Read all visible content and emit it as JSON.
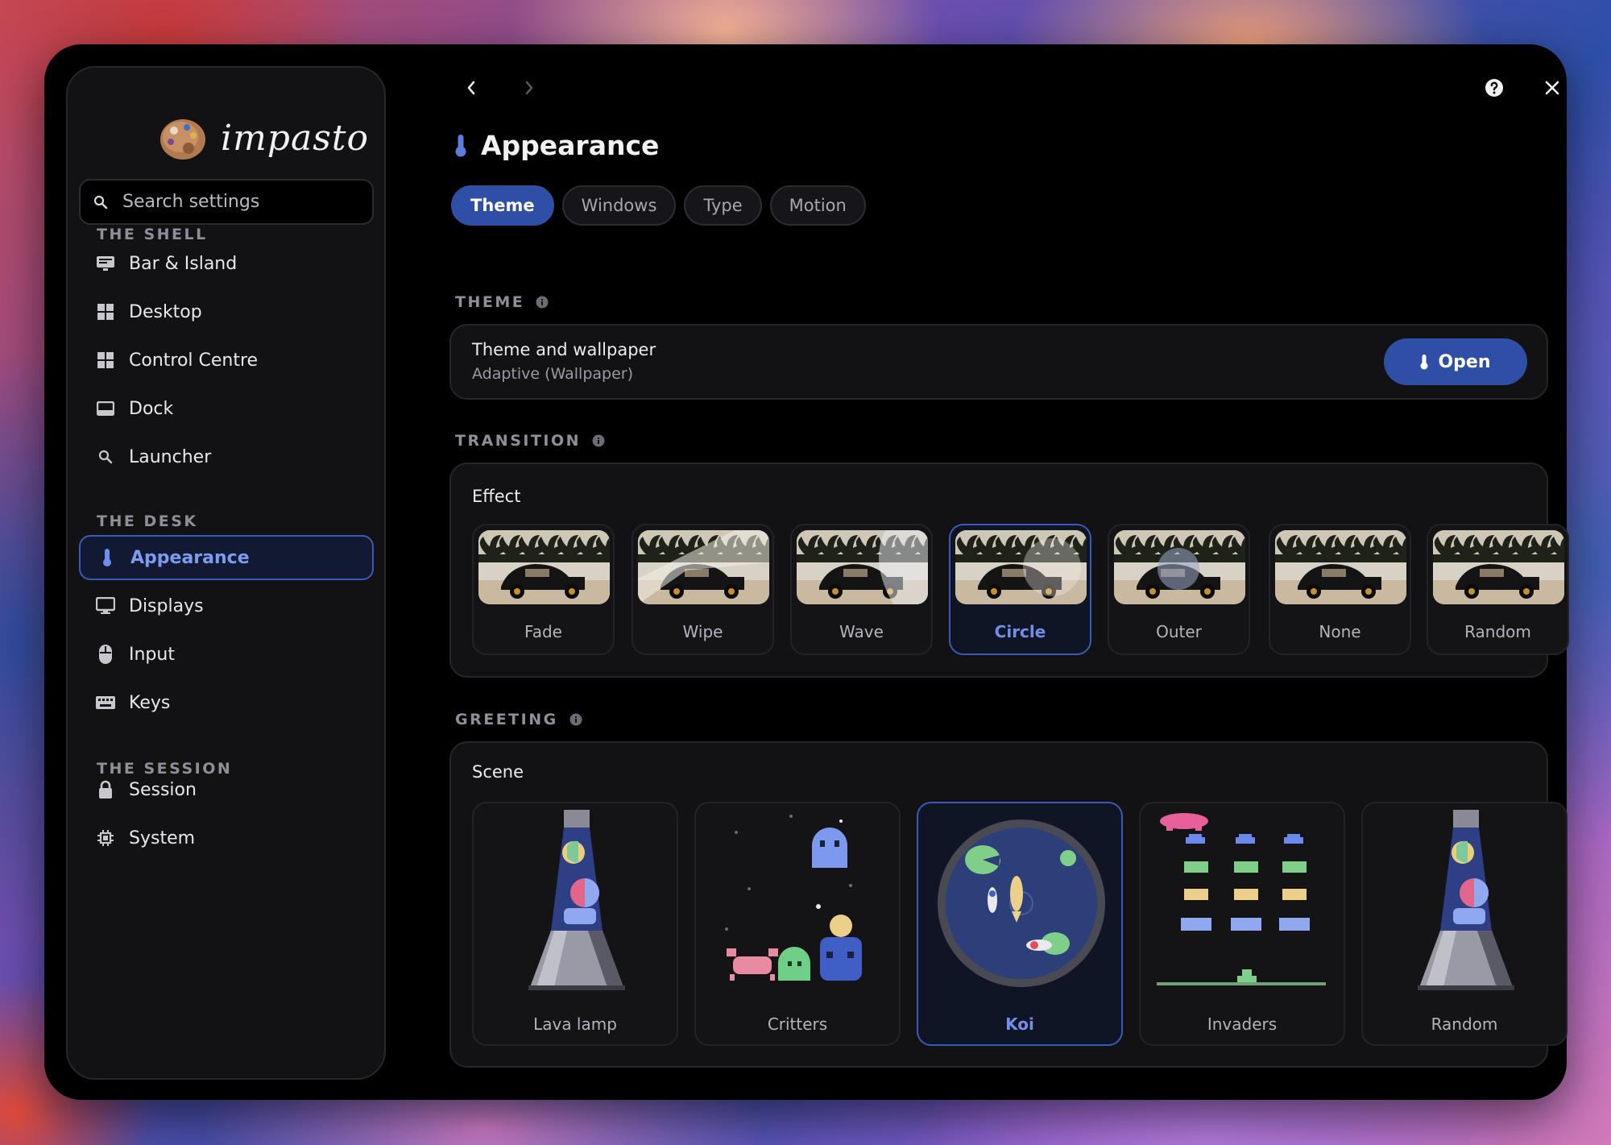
{
  "app": {
    "name": "impasto"
  },
  "search": {
    "placeholder": "Search settings"
  },
  "sidebar": {
    "sections": [
      {
        "label": "THE SHELL",
        "items": [
          {
            "label": "Bar & Island",
            "icon": "monitor-bar-icon"
          },
          {
            "label": "Desktop",
            "icon": "grid-icon"
          },
          {
            "label": "Control Centre",
            "icon": "grid-icon"
          },
          {
            "label": "Dock",
            "icon": "dock-icon"
          },
          {
            "label": "Launcher",
            "icon": "search-icon"
          }
        ]
      },
      {
        "label": "THE DESK",
        "items": [
          {
            "label": "Appearance",
            "icon": "thermometer-icon",
            "active": true
          },
          {
            "label": "Displays",
            "icon": "monitor-icon"
          },
          {
            "label": "Input",
            "icon": "mouse-icon"
          },
          {
            "label": "Keys",
            "icon": "keyboard-icon"
          }
        ]
      },
      {
        "label": "THE SESSION",
        "items": [
          {
            "label": "Session",
            "icon": "lock-icon"
          },
          {
            "label": "System",
            "icon": "cpu-icon"
          }
        ]
      }
    ]
  },
  "page": {
    "title": "Appearance",
    "tabs": [
      {
        "label": "Theme",
        "active": true
      },
      {
        "label": "Windows"
      },
      {
        "label": "Type"
      },
      {
        "label": "Motion"
      }
    ]
  },
  "theme": {
    "header": "THEME",
    "row_title": "Theme and wallpaper",
    "row_subtitle": "Adaptive (Wallpaper)",
    "open_label": "Open"
  },
  "transition": {
    "header": "TRANSITION",
    "row_title": "Effect",
    "effects": [
      "Fade",
      "Wipe",
      "Wave",
      "Circle",
      "Outer",
      "None",
      "Random"
    ],
    "selected": "Circle"
  },
  "greeting": {
    "header": "GREETING",
    "row_title": "Scene",
    "scenes": [
      "Lava lamp",
      "Critters",
      "Koi",
      "Invaders",
      "Random"
    ],
    "selected": "Koi"
  },
  "colors": {
    "accent": "#2f4fa6",
    "accent_text": "#7d9bf0",
    "window_bg": "#000000",
    "panel_bg": "#121214"
  }
}
